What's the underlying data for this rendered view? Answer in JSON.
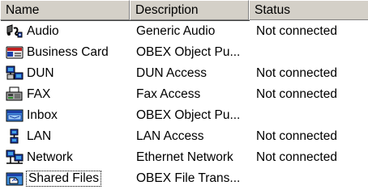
{
  "columns": {
    "name": "Name",
    "description": "Description",
    "status": "Status"
  },
  "rows": [
    {
      "name": "Audio",
      "description": "Generic Audio",
      "status": "Not connected",
      "icon": "audio-service-icon"
    },
    {
      "name": "Business Card",
      "description": "OBEX Object Pu...",
      "status": "",
      "icon": "business-card-icon"
    },
    {
      "name": "DUN",
      "description": "DUN Access",
      "status": "Not connected",
      "icon": "dun-network-icon"
    },
    {
      "name": "FAX",
      "description": "Fax Access",
      "status": "Not connected",
      "icon": "fax-icon"
    },
    {
      "name": "Inbox",
      "description": "OBEX Object Pu...",
      "status": "",
      "icon": "inbox-icon"
    },
    {
      "name": "LAN",
      "description": "LAN Access",
      "status": "Not connected",
      "icon": "lan-icon"
    },
    {
      "name": "Network",
      "description": "Ethernet Network",
      "status": "Not connected",
      "icon": "network-icon"
    },
    {
      "name": "Shared Files",
      "description": "OBEX File Trans...",
      "status": "",
      "icon": "shared-files-icon"
    }
  ],
  "focused_row": "Shared Files"
}
